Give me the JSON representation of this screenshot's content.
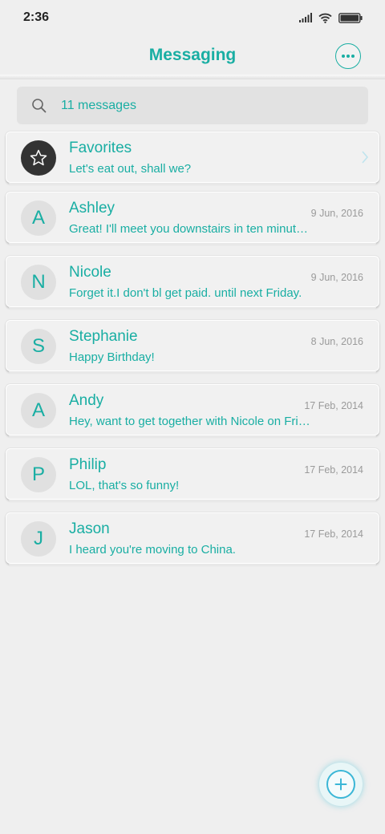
{
  "status_bar": {
    "time": "2:36",
    "icons": [
      "signal-icon",
      "wifi-icon",
      "battery-icon"
    ]
  },
  "header": {
    "title": "Messaging",
    "more_icon": "more-horizontal-icon"
  },
  "search": {
    "icon": "search-icon",
    "text": "11 messages"
  },
  "favorites": {
    "icon": "star-icon",
    "title": "Favorites",
    "preview": "Let's eat out, shall we?"
  },
  "conversations": [
    {
      "initial": "A",
      "name": "Ashley",
      "date": "9 Jun, 2016",
      "preview": "Great! I'll meet you downstairs in ten minut…",
      "unread": false
    },
    {
      "initial": "N",
      "name": "Nicole",
      "date": "9 Jun, 2016",
      "preview": "Forget it.I don't bl get paid. until next Friday.",
      "unread": false
    },
    {
      "initial": "S",
      "name": "Stephanie",
      "date": "8 Jun, 2016",
      "preview": "Happy Birthday!",
      "unread": true
    },
    {
      "initial": "A",
      "name": "Andy",
      "date": "17 Feb, 2014",
      "preview": "Hey, want to get together with Nicole on Fri…",
      "unread": false
    },
    {
      "initial": "P",
      "name": "Philip",
      "date": "17 Feb, 2014",
      "preview": "LOL, that's so funny!",
      "unread": false
    },
    {
      "initial": "J",
      "name": "Jason",
      "date": "17 Feb, 2014",
      "preview": "I heard you're moving to China.",
      "unread": false
    }
  ],
  "fab": {
    "icon": "plus-icon"
  },
  "colors": {
    "accent": "#19aea3",
    "date": "#9a9a9a",
    "background": "#efefef"
  }
}
